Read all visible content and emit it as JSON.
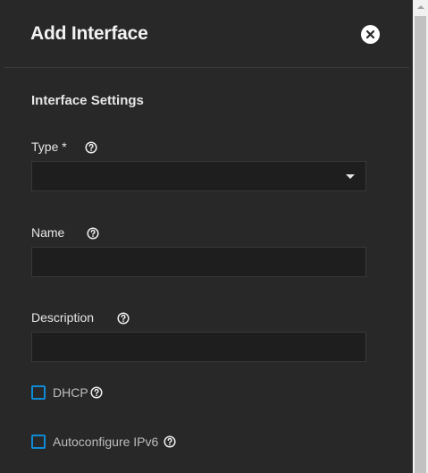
{
  "dialog": {
    "title": "Add Interface",
    "close_icon": "close-icon"
  },
  "section": {
    "title": "Interface Settings"
  },
  "fields": {
    "type": {
      "label": "Type *",
      "value": "",
      "help_icon": "help-circle-icon"
    },
    "name": {
      "label": "Name",
      "value": "",
      "help_icon": "help-circle-icon"
    },
    "description": {
      "label": "Description",
      "value": "",
      "help_icon": "help-circle-icon"
    }
  },
  "checkboxes": {
    "dhcp": {
      "label": "DHCP",
      "checked": false
    },
    "autoconfigure_ipv6": {
      "label": "Autoconfigure IPv6",
      "checked": false
    }
  },
  "colors": {
    "background": "#282828",
    "input_background": "#1e1e1e",
    "checkbox_accent": "#0f8bd6",
    "text": "#e6e6e6"
  }
}
